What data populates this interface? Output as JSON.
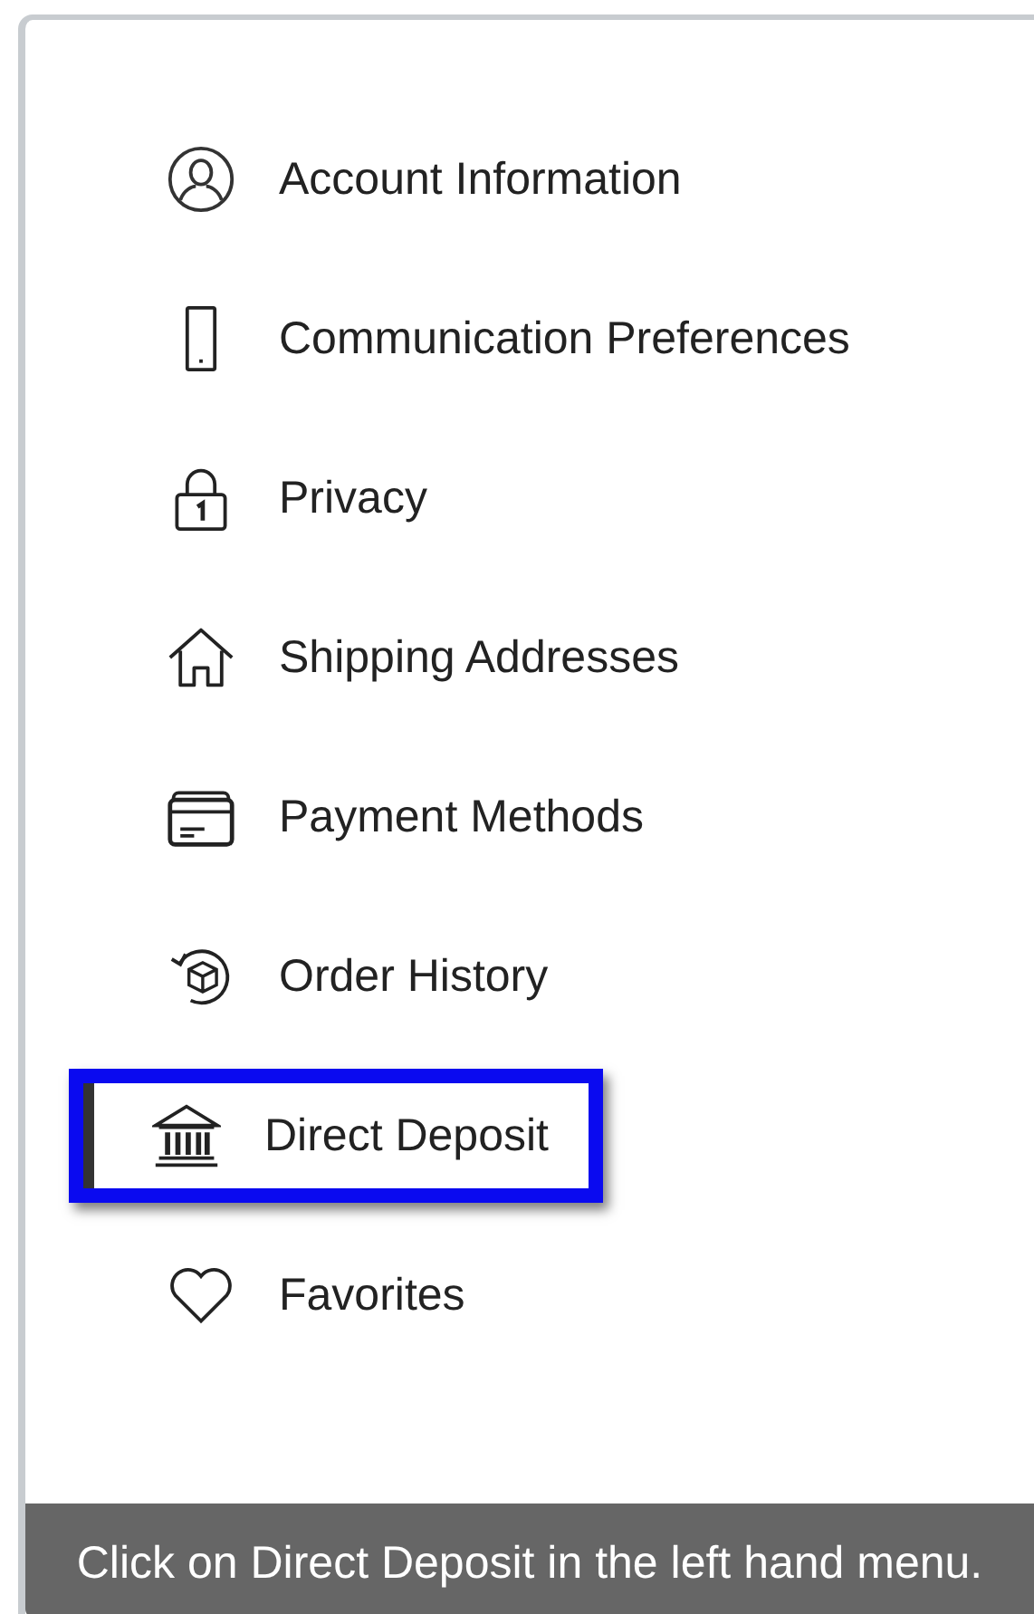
{
  "menu": {
    "items": [
      {
        "kind": "account",
        "label": "Account Information",
        "selected": false
      },
      {
        "kind": "phone",
        "label": "Communication Preferences",
        "selected": false
      },
      {
        "kind": "lock",
        "label": "Privacy",
        "selected": false
      },
      {
        "kind": "home",
        "label": "Shipping Addresses",
        "selected": false
      },
      {
        "kind": "cards",
        "label": "Payment Methods",
        "selected": false
      },
      {
        "kind": "history",
        "label": "Order History",
        "selected": false
      },
      {
        "kind": "bank",
        "label": "Direct Deposit",
        "selected": true
      },
      {
        "kind": "heart",
        "label": "Favorites",
        "selected": false
      }
    ]
  },
  "caption": "Click on Direct Deposit in the left hand menu."
}
